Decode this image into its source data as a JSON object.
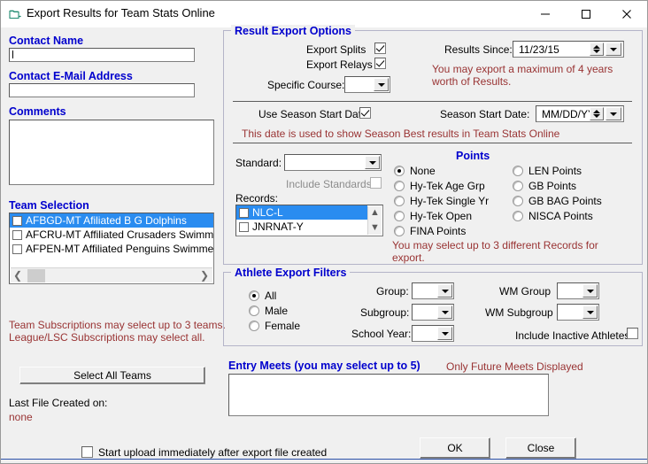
{
  "window": {
    "title": "Export Results for Team Stats Online",
    "icon": "export-folder-icon",
    "minimize_label": "–",
    "maximize_label": "□",
    "close_label": "✕"
  },
  "contact": {
    "name_label": "Contact Name",
    "name_value": "",
    "email_label": "Contact E-Mail Address",
    "email_value": "",
    "comments_label": "Comments",
    "comments_value": ""
  },
  "team_selection": {
    "title": "Team Selection",
    "items": [
      {
        "label": "AFBGD-MT Afiliated B G Dolphins",
        "checked": false,
        "selected": true
      },
      {
        "label": "AFCRU-MT Affiliated Crusaders Swimmers",
        "checked": false,
        "selected": false
      },
      {
        "label": "AFPEN-MT Affiliated Penguins Swimmers",
        "checked": false,
        "selected": false
      }
    ],
    "note_line1": "Team Subscriptions may select up to 3 teams.",
    "note_line2": "League/LSC Subscriptions may select all.",
    "select_all_label": "Select All Teams"
  },
  "last_file": {
    "label": "Last File Created on:",
    "value": "none"
  },
  "result_export_options": {
    "title": "Result Export Options",
    "export_splits_label": "Export Splits",
    "export_splits_checked": true,
    "export_relays_label": "Export Relays",
    "export_relays_checked": true,
    "specific_course_label": "Specific Course:",
    "specific_course_value": "",
    "results_since_label": "Results Since:",
    "results_since_value": "11/23/15",
    "max_years_note": "You may export a maximum of 4 years worth of Results.",
    "use_season_start_label": "Use Season Start Date",
    "use_season_start_checked": true,
    "season_start_label": "Season Start Date:",
    "season_start_value": "MM/DD/YY",
    "season_note": "This date is used to show Season Best results in Team Stats Online",
    "standard_label": "Standard:",
    "standard_value": "",
    "include_standards_label": "Include Standards",
    "include_standards_checked": false,
    "records_label": "Records:",
    "records_items": [
      {
        "label": "NLC-L",
        "checked": false,
        "selected": true
      },
      {
        "label": "JNRNAT-Y",
        "checked": false,
        "selected": false
      }
    ],
    "records_note": "You may select up to 3 different Records for export.",
    "points_title": "Points",
    "points_col1": [
      {
        "label": "None",
        "selected": true
      },
      {
        "label": "Hy-Tek Age Grp",
        "selected": false
      },
      {
        "label": "Hy-Tek Single Yr",
        "selected": false
      },
      {
        "label": "Hy-Tek Open",
        "selected": false
      },
      {
        "label": "FINA Points",
        "selected": false
      }
    ],
    "points_col2": [
      {
        "label": "LEN Points",
        "selected": false
      },
      {
        "label": "GB Points",
        "selected": false
      },
      {
        "label": "GB BAG Points",
        "selected": false
      },
      {
        "label": "NISCA Points",
        "selected": false
      }
    ]
  },
  "athlete_export_filters": {
    "title": "Athlete Export Filters",
    "gender": [
      {
        "label": "All",
        "selected": true
      },
      {
        "label": "Male",
        "selected": false
      },
      {
        "label": "Female",
        "selected": false
      }
    ],
    "group_label": "Group:",
    "group_value": "",
    "subgroup_label": "Subgroup:",
    "subgroup_value": "",
    "school_year_label": "School Year:",
    "school_year_value": "",
    "wm_group_label": "WM Group",
    "wm_group_value": "",
    "wm_subgroup_label": "WM Subgroup",
    "wm_subgroup_value": "",
    "include_inactive_label": "Include Inactive Athletes",
    "include_inactive_checked": false
  },
  "entry_meets": {
    "title": "Entry Meets (you may select up to 5)",
    "note": "Only Future Meets Displayed",
    "items": []
  },
  "footer": {
    "start_upload_label": "Start upload immediately after export file created",
    "start_upload_checked": false,
    "ok_label": "OK",
    "close_label": "Close"
  },
  "colors": {
    "label_blue": "#0000cd",
    "note_red": "#993333",
    "selection_blue": "#2a8cf0",
    "window_bg": "#f0f0f0"
  }
}
